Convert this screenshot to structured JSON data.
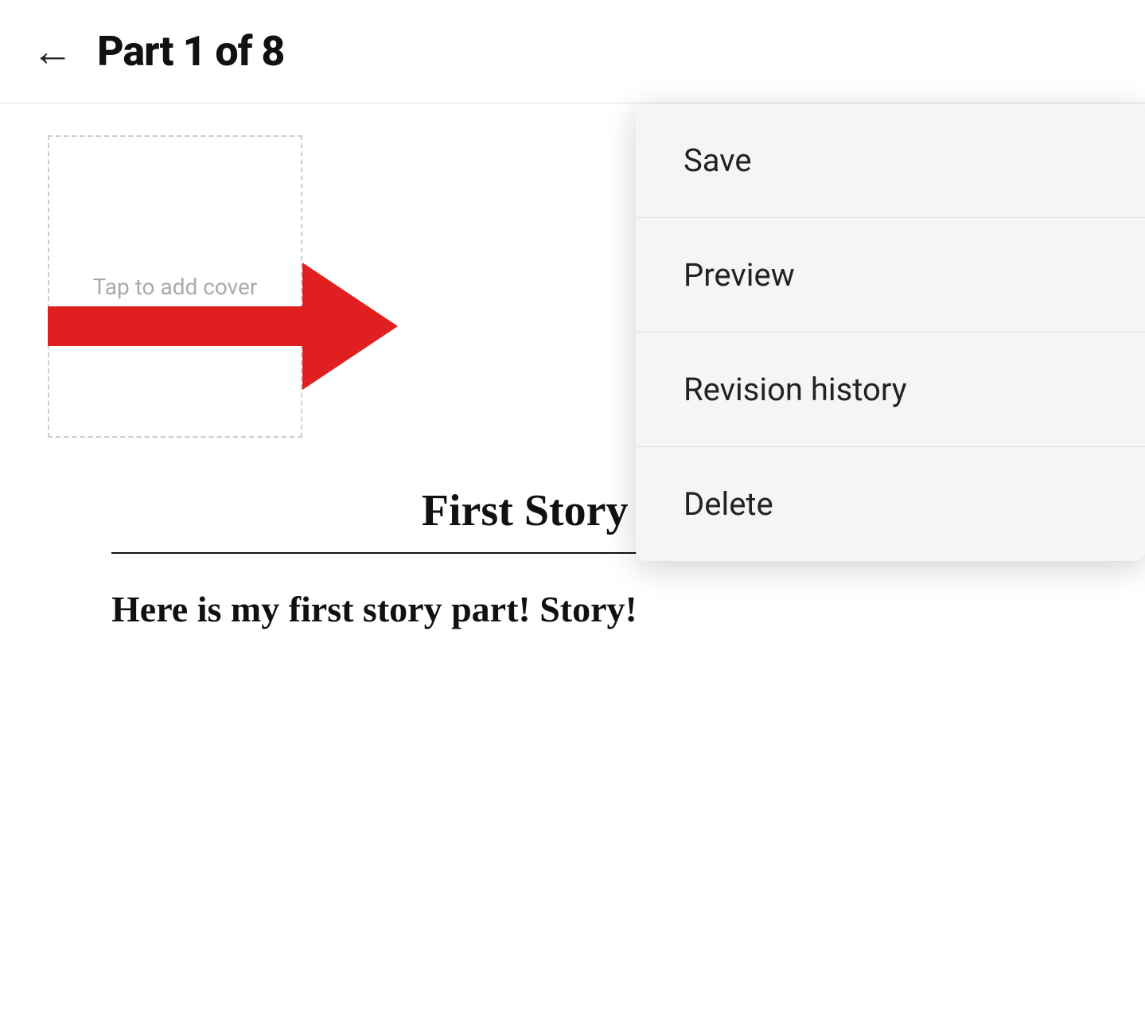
{
  "header": {
    "back_label": "←",
    "title": "Part 1 of 8"
  },
  "cover": {
    "placeholder_text": "Tap to add cover"
  },
  "arrow": {
    "color": "#e02020"
  },
  "story": {
    "title": "First Story Part",
    "content": "Here is my first story part! Story!"
  },
  "dropdown": {
    "items": [
      {
        "id": "save",
        "label": "Save"
      },
      {
        "id": "preview",
        "label": "Preview"
      },
      {
        "id": "revision-history",
        "label": "Revision history"
      },
      {
        "id": "delete",
        "label": "Delete"
      }
    ]
  }
}
